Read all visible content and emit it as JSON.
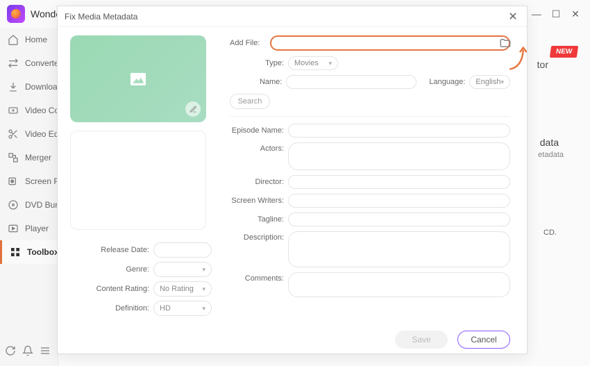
{
  "app": {
    "title": "Wonder"
  },
  "titlebar": {
    "min": "—",
    "max": "☐",
    "close": "✕"
  },
  "sidebar": {
    "items": [
      {
        "label": "Home",
        "icon": "home"
      },
      {
        "label": "Converter",
        "icon": "convert"
      },
      {
        "label": "Download",
        "icon": "download"
      },
      {
        "label": "Video Co",
        "icon": "compress"
      },
      {
        "label": "Video Ed",
        "icon": "scissors"
      },
      {
        "label": "Merger",
        "icon": "merge"
      },
      {
        "label": "Screen R",
        "icon": "record"
      },
      {
        "label": "DVD Bur",
        "icon": "disc"
      },
      {
        "label": "Player",
        "icon": "play"
      },
      {
        "label": "Toolbox",
        "icon": "toolbox"
      }
    ]
  },
  "content_bg": {
    "new_badge": "NEW",
    "tor": "tor",
    "fix_title": "data",
    "fix_sub": "etadata",
    "cd": "CD."
  },
  "modal": {
    "title": "Fix Media Metadata",
    "add_file_label": "Add File:",
    "type_label": "Type:",
    "type_value": "Movies",
    "name_label": "Name:",
    "language_label": "Language:",
    "language_value": "English",
    "search_label": "Search",
    "episode_label": "Episode Name:",
    "actors_label": "Actors:",
    "director_label": "Director:",
    "writers_label": "Screen Writers:",
    "tagline_label": "Tagline:",
    "description_label": "Description:",
    "comments_label": "Comments:",
    "release_label": "Release Date:",
    "genre_label": "Genre:",
    "rating_label": "Content Rating:",
    "rating_value": "No Rating",
    "definition_label": "Definition:",
    "definition_value": "HD",
    "save": "Save",
    "cancel": "Cancel"
  }
}
